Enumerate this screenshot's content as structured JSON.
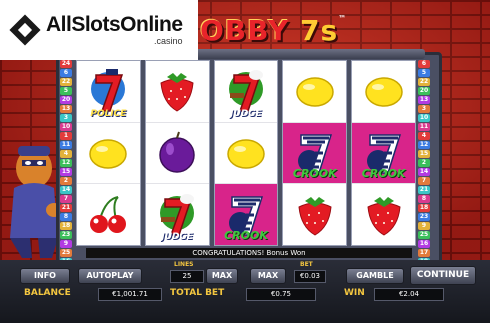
{
  "watermark": {
    "brand": "AllSlotsOnline",
    "tld": ".casino"
  },
  "game": {
    "title_word": "OBBY",
    "title_seven": "7s",
    "trademark": "™"
  },
  "colors": {
    "accent": "#f3c640",
    "brick": "#c2271d",
    "panel": "#2a2d38"
  },
  "paylines": {
    "left": [
      "24",
      "6",
      "22",
      "5",
      "20",
      "13",
      "3",
      "10",
      "1",
      "11",
      "4",
      "12",
      "15",
      "2",
      "14",
      "7",
      "21",
      "8",
      "18",
      "23",
      "9",
      "25",
      "16",
      "17"
    ],
    "right": [
      "6",
      "5",
      "22",
      "20",
      "13",
      "3",
      "10",
      "11",
      "4",
      "12",
      "15",
      "2",
      "14",
      "7",
      "21",
      "8",
      "18",
      "23",
      "9",
      "25",
      "16",
      "17",
      "19",
      "24"
    ]
  },
  "reels": [
    [
      {
        "symbol": "police-seven",
        "tag": "POLICE"
      },
      {
        "symbol": "lemon",
        "tag": ""
      },
      {
        "symbol": "cherry",
        "tag": ""
      }
    ],
    [
      {
        "symbol": "strawberry",
        "tag": ""
      },
      {
        "symbol": "plum",
        "tag": ""
      },
      {
        "symbol": "judge-seven",
        "tag": "JUDGE"
      }
    ],
    [
      {
        "symbol": "judge-seven",
        "tag": "JUDGE"
      },
      {
        "symbol": "lemon",
        "tag": ""
      },
      {
        "symbol": "crook-seven",
        "tag": "CROOK"
      }
    ],
    [
      {
        "symbol": "lemon",
        "tag": ""
      },
      {
        "symbol": "crook-seven",
        "tag": "CROOK"
      },
      {
        "symbol": "strawberry",
        "tag": ""
      }
    ],
    [
      {
        "symbol": "lemon",
        "tag": ""
      },
      {
        "symbol": "crook-seven",
        "tag": "CROOK"
      },
      {
        "symbol": "strawberry",
        "tag": ""
      }
    ]
  ],
  "status_message": "CONGRATULATIONS! Bonus Won",
  "controls": {
    "info_label": "INFO",
    "autoplay_label": "AUTOPLAY",
    "lines_label": "LINES",
    "lines_value": "25",
    "max_lines_label": "MAX",
    "bet_label": "BET",
    "bet_value": "€0.03",
    "max_bet_label": "MAX",
    "gamble_label": "GAMBLE",
    "continue_label": "CONTINUE",
    "balance_label": "BALANCE",
    "balance_value": "€1,001.71",
    "total_bet_label": "TOTAL BET",
    "total_bet_value": "€0.75",
    "win_label": "WIN",
    "win_value": "€2.04"
  }
}
